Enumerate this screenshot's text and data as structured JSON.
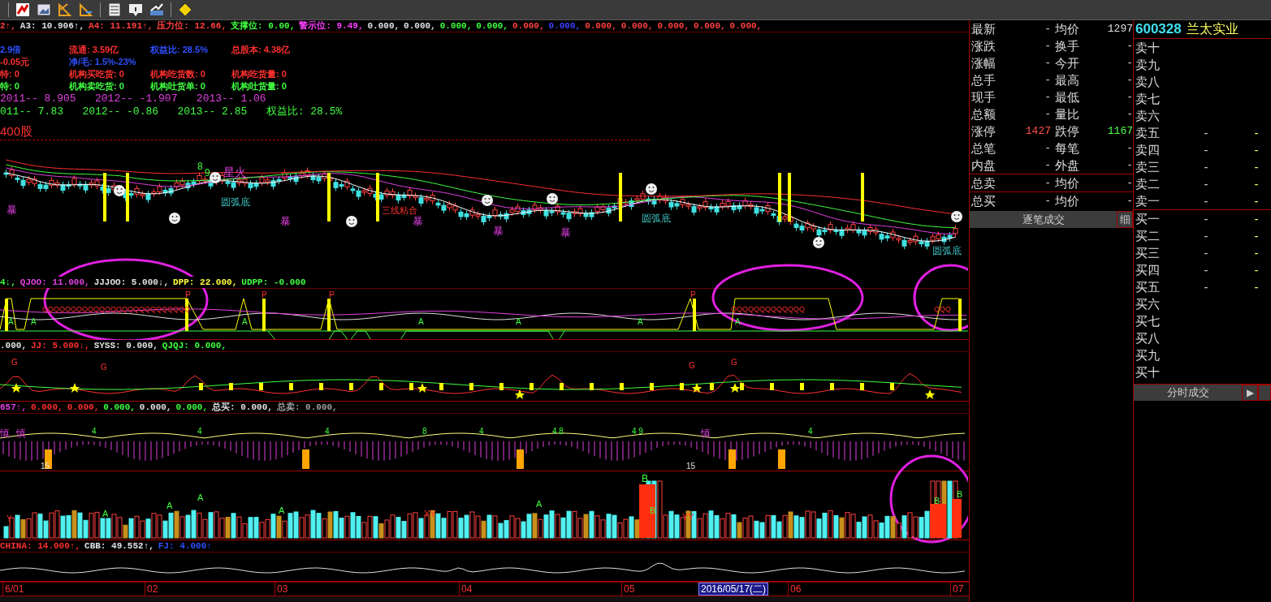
{
  "main_chart": {
    "header": [
      {
        "text": "2↑,",
        "color": "#ff4040"
      },
      {
        "text": "A3: 10.906↑,",
        "color": "#e0e0e0"
      },
      {
        "text": "A4: 11.191↑,",
        "color": "#ff4040"
      },
      {
        "text": "压力位: 12.66,",
        "color": "#ff4040"
      },
      {
        "text": "支撑位: 0.00,",
        "color": "#40ff40"
      },
      {
        "text": "警示位: 9.49,",
        "color": "#ff40ff"
      },
      {
        "text": "0.000,",
        "color": "#e0e0e0"
      },
      {
        "text": "0.000,",
        "color": "#e0e0e0"
      },
      {
        "text": "0.000,",
        "color": "#40ff40"
      },
      {
        "text": "0.000,",
        "color": "#40ff40"
      },
      {
        "text": "0.000,",
        "color": "#ff4040"
      },
      {
        "text": "0.000,",
        "color": "#4040ff"
      },
      {
        "text": "0.000,",
        "color": "#ff4040"
      },
      {
        "text": "0.000,",
        "color": "#ff4040"
      },
      {
        "text": "0.000,",
        "color": "#ff4040"
      },
      {
        "text": "0.000,",
        "color": "#ff4040"
      },
      {
        "text": "0.000,",
        "color": "#ff4040"
      }
    ],
    "info_rows": [
      [
        {
          "text": "2.9倍",
          "color": "#3050ff"
        },
        {
          "text": "流通: 3.59亿",
          "color": "#ff3030"
        },
        {
          "text": "权益比: 28.5%",
          "color": "#3050ff"
        },
        {
          "text": "总股本: 4.38亿",
          "color": "#ff3030"
        }
      ],
      [
        {
          "text": "-0.05元",
          "color": "#ff3030"
        },
        {
          "text": "净/毛: 1.5%-23%",
          "color": "#3050ff"
        }
      ],
      [
        {
          "text": "特: 0",
          "color": "#ff3030"
        },
        {
          "text": "机构买吃货: 0",
          "color": "#ff3030"
        },
        {
          "text": "机构吃货数: 0",
          "color": "#ff3030"
        },
        {
          "text": "机构吃货量: 0",
          "color": "#ff3030"
        }
      ],
      [
        {
          "text": "特: 0",
          "color": "#40ff40"
        },
        {
          "text": "机构卖吃货: 0",
          "color": "#40ff40"
        },
        {
          "text": "机构吐货单: 0",
          "color": "#40ff40"
        },
        {
          "text": "机构吐货量: 0",
          "color": "#40ff40"
        }
      ]
    ],
    "eps_rows": [
      {
        "text": "2011-- 8.905   2012-- -1.907   2013-- 1.06",
        "color": "#e040e0"
      },
      {
        "text": "011-- 7.83   2012-- -0.86   2013-- 2.85   权益比: 28.5%",
        "color": "#40ff40"
      }
    ],
    "volume_note": "400股",
    "marks": [
      {
        "text": "星火",
        "kind": "signal"
      },
      {
        "text": "圆弧底",
        "kind": "pattern"
      },
      {
        "text": "圆弧底",
        "kind": "pattern"
      },
      {
        "text": "圆弧底",
        "kind": "pattern"
      },
      {
        "text": "三线粘合",
        "kind": "alert"
      },
      {
        "text": "暴",
        "kind": "signal"
      },
      {
        "text": "暴",
        "kind": "signal"
      },
      {
        "text": "暴",
        "kind": "signal"
      },
      {
        "text": "暴",
        "kind": "signal"
      },
      {
        "text": "暴",
        "kind": "signal"
      },
      {
        "text": "8",
        "kind": "count"
      },
      {
        "text": "9",
        "kind": "count"
      }
    ]
  },
  "panels": [
    {
      "kind": "trend",
      "header": [
        {
          "text": "4↓,",
          "color": "#40ff40"
        },
        {
          "text": "QJOO: 11.000,",
          "color": "#e040e0"
        },
        {
          "text": "JJJOO: 5.000↓,",
          "color": "#e0e0e0"
        },
        {
          "text": "DPP: 22.000,",
          "color": "#ffff40"
        },
        {
          "text": "UDPP: -0.000",
          "color": "#40ff40"
        }
      ],
      "marks": [
        {
          "text": "QQQQQQQQQQQQQQQQQQQQQQQQQQ",
          "kind": "alert"
        },
        {
          "text": "QQQQQQQQQQQQQ",
          "kind": "alert"
        },
        {
          "text": "QQQ",
          "kind": "alert"
        },
        {
          "text": "A",
          "kind": "count"
        },
        {
          "text": "A",
          "kind": "count"
        },
        {
          "text": "A",
          "kind": "count"
        },
        {
          "text": "A",
          "kind": "count"
        },
        {
          "text": "A",
          "kind": "count"
        },
        {
          "text": "A",
          "kind": "count"
        },
        {
          "text": "A",
          "kind": "count"
        },
        {
          "text": "P",
          "kind": "alert"
        },
        {
          "text": "P",
          "kind": "alert"
        },
        {
          "text": "P",
          "kind": "alert"
        },
        {
          "text": "P",
          "kind": "alert"
        }
      ]
    },
    {
      "kind": "signal",
      "header": [
        {
          "text": ".000,",
          "color": "#e0e0e0"
        },
        {
          "text": "JJ: 5.000↓,",
          "color": "#ff3030"
        },
        {
          "text": "SYSS: 0.000,",
          "color": "#e0e0e0"
        },
        {
          "text": "QJQJ: 0.000,",
          "color": "#40ff40"
        }
      ],
      "marks": [
        {
          "text": "G",
          "kind": "alert"
        },
        {
          "text": "G",
          "kind": "alert"
        },
        {
          "text": "G",
          "kind": "alert"
        },
        {
          "text": "G",
          "kind": "alert"
        }
      ]
    },
    {
      "kind": "wave",
      "header": [
        {
          "text": "657↑,",
          "color": "#e040e0"
        },
        {
          "text": "0.000,",
          "color": "#ff3030"
        },
        {
          "text": "0.000,",
          "color": "#ff3030"
        },
        {
          "text": "0.000,",
          "color": "#40ff40"
        },
        {
          "text": "0.000,",
          "color": "#e0e0e0"
        },
        {
          "text": "0.000,",
          "color": "#40ff40"
        },
        {
          "text": "总买: 0.000,",
          "color": "#e0e0e0"
        },
        {
          "text": "总卖: 0.000,",
          "color": "#a0a0a0"
        }
      ],
      "marks": [
        {
          "text": "慎",
          "kind": "signal"
        },
        {
          "text": "慎",
          "kind": "signal"
        },
        {
          "text": "4",
          "kind": "count"
        },
        {
          "text": "4",
          "kind": "count"
        },
        {
          "text": "4",
          "kind": "count"
        },
        {
          "text": "8",
          "kind": "count"
        },
        {
          "text": "4",
          "kind": "count"
        },
        {
          "text": "4 8",
          "kind": "count"
        },
        {
          "text": "4 9",
          "kind": "count"
        },
        {
          "text": "慎",
          "kind": "signal"
        },
        {
          "text": "4",
          "kind": "count"
        },
        {
          "text": "15",
          "kind": "plain"
        },
        {
          "text": "15",
          "kind": "plain"
        }
      ]
    },
    {
      "kind": "volume",
      "marks": [
        {
          "text": "B",
          "kind": "count"
        },
        {
          "text": "B",
          "kind": "count"
        },
        {
          "text": "B",
          "kind": "count"
        },
        {
          "text": "B",
          "kind": "count"
        },
        {
          "text": "Y",
          "kind": "alert"
        },
        {
          "text": "YY",
          "kind": "alert"
        },
        {
          "text": "YY",
          "kind": "alert"
        },
        {
          "text": "A",
          "kind": "count"
        },
        {
          "text": "A",
          "kind": "count"
        },
        {
          "text": "A",
          "kind": "count"
        },
        {
          "text": "A",
          "kind": "count"
        },
        {
          "text": "A",
          "kind": "count"
        }
      ]
    },
    {
      "kind": "line",
      "header": [
        {
          "text": "CHINA: 14.000↑,",
          "color": "#ff3030"
        },
        {
          "text": "CBB: 49.552↑,",
          "color": "#e0e0e0"
        },
        {
          "text": "FJ: 4.000↑",
          "color": "#3050ff"
        }
      ]
    }
  ],
  "date_axis": [
    {
      "text": "6/01",
      "selected": false
    },
    {
      "text": "02",
      "selected": false
    },
    {
      "text": "03",
      "selected": false
    },
    {
      "text": "04",
      "selected": false
    },
    {
      "text": "05",
      "selected": false
    },
    {
      "text": "2016/05/17(二)",
      "selected": true
    },
    {
      "text": "06",
      "selected": false
    },
    {
      "text": "07",
      "selected": false
    }
  ],
  "quote": {
    "rows": [
      {
        "kind": "normal",
        "label": "最新",
        "value": "-",
        "label2": "均价",
        "value2": "1297"
      },
      {
        "kind": "normal",
        "label": "涨跌",
        "value": "-",
        "label2": "换手",
        "value2": "-"
      },
      {
        "kind": "normal",
        "label": "涨幅",
        "value": "-",
        "label2": "今开",
        "value2": "-"
      },
      {
        "kind": "normal",
        "label": "总手",
        "value": "-",
        "label2": "最高",
        "value2": "-"
      },
      {
        "kind": "normal",
        "label": "现手",
        "value": "-",
        "label2": "最低",
        "value2": "-"
      },
      {
        "kind": "normal",
        "label": "总额",
        "value": "-",
        "label2": "量比",
        "value2": "-"
      },
      {
        "kind": "limits",
        "label": "涨停",
        "value": "1427",
        "label2": "跌停",
        "value2": "1167"
      },
      {
        "kind": "normal",
        "label": "总笔",
        "value": "-",
        "label2": "每笔",
        "value2": "-"
      },
      {
        "kind": "normal",
        "label": "内盘",
        "value": "-",
        "label2": "外盘",
        "value2": "-"
      },
      {
        "kind": "boxed",
        "label": "总卖",
        "value": "-",
        "label2": "均价",
        "value2": "-"
      },
      {
        "kind": "boxed",
        "label": "总买",
        "value": "-",
        "label2": "均价",
        "value2": "-"
      }
    ],
    "tab": "逐笔成交",
    "detail": "细"
  },
  "order_book": {
    "code": "600328",
    "name": "兰太实业",
    "rows": [
      {
        "label": "卖十"
      },
      {
        "label": "卖九"
      },
      {
        "label": "卖八"
      },
      {
        "label": "卖七"
      },
      {
        "label": "卖六"
      },
      {
        "label": "卖五",
        "price": "-",
        "volume": "-"
      },
      {
        "label": "卖四",
        "price": "-",
        "volume": "-"
      },
      {
        "label": "卖三",
        "price": "-",
        "volume": "-"
      },
      {
        "label": "卖二",
        "price": "-",
        "volume": "-"
      },
      {
        "label": "卖一",
        "price": "-",
        "volume": "-"
      },
      {
        "label": "买一",
        "price": "-",
        "volume": "-"
      },
      {
        "label": "买二",
        "price": "-",
        "volume": "-"
      },
      {
        "label": "买三",
        "price": "-",
        "volume": "-"
      },
      {
        "label": "买四",
        "price": "-",
        "volume": "-"
      },
      {
        "label": "买五",
        "price": "-",
        "volume": "-"
      },
      {
        "label": "买六"
      },
      {
        "label": "买七"
      },
      {
        "label": "买八"
      },
      {
        "label": "买九"
      },
      {
        "label": "买十"
      }
    ],
    "tab": "分时成交",
    "arrow": "▶"
  }
}
